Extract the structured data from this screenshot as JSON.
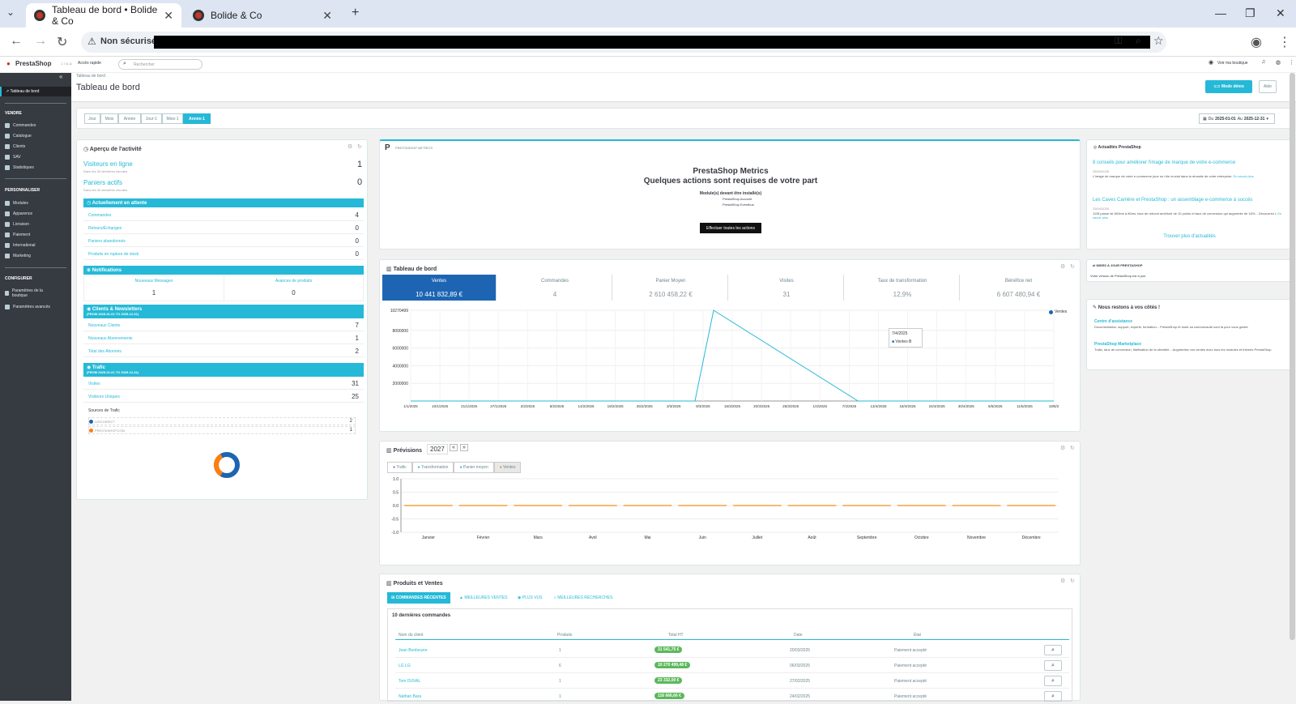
{
  "browser": {
    "tabs": [
      {
        "title": "Tableau de bord • Bolide & Co"
      },
      {
        "title": "Bolide & Co"
      }
    ],
    "security": "Non sécurisé"
  },
  "header": {
    "logo": "PrestaShop",
    "version": "1.7.8.11",
    "quick_access": "Accès rapide",
    "search_placeholder": "Rechercher",
    "view_shop": "Voir ma boutique"
  },
  "sidebar": {
    "dashboard": "Tableau de bord",
    "sections": [
      {
        "title": "VENDRE",
        "items": [
          "Commandes",
          "Catalogue",
          "Clients",
          "SAV",
          "Statistiques"
        ]
      },
      {
        "title": "PERSONNALISER",
        "items": [
          "Modules",
          "Apparence",
          "Livraison",
          "Paiement",
          "International",
          "Marketing"
        ]
      },
      {
        "title": "CONFIGURER",
        "items": [
          "Paramètres de la boutique",
          "Paramètres avancés"
        ]
      }
    ]
  },
  "page": {
    "breadcrumb": "Tableau de bord",
    "title": "Tableau de bord",
    "demo_button": "Mode démo",
    "help_button": "Aide"
  },
  "periods": [
    "Jour",
    "Mois",
    "Année",
    "Jour-1",
    "Mois-1",
    "Année-1"
  ],
  "active_period": "Année-1",
  "date_range": {
    "from_label": "Du",
    "from": "2025-01-01",
    "to_label": "Au",
    "to": "2025-12-31"
  },
  "activity": {
    "title": "Aperçu de l'activité",
    "online_visitors": {
      "label": "Visiteurs en ligne",
      "sub": "Dans les 30 dernières minutes",
      "value": "1"
    },
    "active_carts": {
      "label": "Paniers actifs",
      "sub": "Dans les 30 dernières minutes",
      "value": "0"
    },
    "pending": {
      "title": "Actuellement en attente",
      "rows": [
        {
          "label": "Commandes",
          "value": "4"
        },
        {
          "label": "Retours/Échanges",
          "value": "0"
        },
        {
          "label": "Paniers abandonnés",
          "value": "0"
        },
        {
          "label": "Produits en rupture de stock",
          "value": "0"
        }
      ]
    },
    "notifications": {
      "title": "Notifications",
      "cols": [
        {
          "label": "Nouveaux Messages",
          "value": "1"
        },
        {
          "label": "Avances de produits",
          "value": "0"
        }
      ]
    },
    "clients": {
      "title": "Clients & Newsletters",
      "sub": "(FROM 2025-01-01 TO 2025-12-31)",
      "rows": [
        {
          "label": "Nouveaux Clients",
          "value": "7"
        },
        {
          "label": "Nouveaux Abonnements",
          "value": "1"
        },
        {
          "label": "Total des Abonnés",
          "value": "2"
        }
      ]
    },
    "traffic": {
      "title": "Trafic",
      "sub": "(FROM 2025-01-01 TO 2025-12-31)",
      "rows": [
        {
          "label": "Visites",
          "value": "31"
        },
        {
          "label": "Visiteurs Uniques",
          "value": "25"
        }
      ],
      "sources_title": "Sources de Trafic",
      "sources": [
        {
          "label": "LIEN DIRECT",
          "value": "2",
          "color": "#1d65b3"
        },
        {
          "label": "PRESTASHOP.COM",
          "value": "1",
          "color": "#ff7f0e"
        }
      ]
    }
  },
  "metrics": {
    "title": "PRESTASHOP METRICS",
    "heading1": "PrestaShop Metrics",
    "heading2": "Quelques actions sont requises de votre part",
    "modules_title": "Module(s) devant être installé(s)",
    "modules": [
      "PrestaShop Account",
      "PrestaShop Eventbus"
    ],
    "action_button": "Effectuer toutes les actions"
  },
  "dashboard": {
    "title": "Tableau de bord",
    "kpis": [
      {
        "label": "Ventes",
        "value": "10 441 832,89 €"
      },
      {
        "label": "Commandes",
        "value": "4"
      },
      {
        "label": "Panier Moyen",
        "value": "2 610 458,22 €"
      },
      {
        "label": "Visites",
        "value": "31"
      },
      {
        "label": "Taux de transformation",
        "value": "12,9%"
      },
      {
        "label": "Bénéfice net",
        "value": "6 607 480,94 €"
      }
    ],
    "legend": "Ventes",
    "tooltip": {
      "date": "7/4/2025",
      "label": "Ventes",
      "value": "0"
    },
    "x_labels": [
      "1/1/2025",
      "10/1/2025",
      "21/1/2025",
      "27/1/2025",
      "2/2/2025",
      "8/2/2025",
      "14/2/2025",
      "19/2/2025",
      "25/2/2025",
      "3/3/2025",
      "9/3/2025",
      "15/3/2025",
      "20/3/2025",
      "26/3/2025",
      "1/4/2025",
      "7/4/2025",
      "13/4/2025",
      "18/4/2025",
      "24/4/2025",
      "30/4/2025",
      "6/5/2025",
      "11/5/2025",
      "19/5/2"
    ],
    "y_labels": [
      "10270499",
      "8000000",
      "6000000",
      "4000000",
      "2000000"
    ]
  },
  "chart_data": {
    "type": "line",
    "title": "Tableau de bord",
    "series": [
      {
        "name": "Ventes",
        "x": [
          "1/1/2025",
          "3/3/2025",
          "7/3/2025",
          "7/4/2025",
          "19/5/2025"
        ],
        "values": [
          0,
          0,
          10270499,
          0,
          0
        ]
      }
    ],
    "ylim": [
      0,
      10270499
    ]
  },
  "forecast": {
    "title": "Prévisions",
    "year": "2027",
    "tabs": [
      "Trafic",
      "Transformation",
      "Panier moyen",
      "Ventes"
    ],
    "months": [
      "Janvier",
      "Février",
      "Mars",
      "Avril",
      "Mai",
      "Juin",
      "Juillet",
      "Août",
      "Septembre",
      "Octobre",
      "Novembre",
      "Décembre"
    ],
    "y_labels": [
      "1.0",
      "0.5",
      "0.0",
      "-0.5",
      "-1.0"
    ]
  },
  "products": {
    "title": "Produits et Ventes",
    "tabs": [
      "COMMANDES RÉCENTES",
      "MEILLEURES VENTES",
      "PLUS VUS",
      "MEILLEURES RECHERCHES"
    ],
    "subtitle": "10 dernières commandes",
    "columns": [
      "Nom du client",
      "Produits",
      "Total HT",
      "Date",
      "État"
    ],
    "rows": [
      {
        "name": "Jean Bonbeurre",
        "products": "1",
        "total": "31 541,75 €",
        "date": "20/03/2025",
        "state": "Paiement accepté"
      },
      {
        "name": "LG LG",
        "products": "6",
        "total": "10 270 499,48 €",
        "date": "06/03/2025",
        "state": "Paiement accepté"
      },
      {
        "name": "Tom DUVAL",
        "products": "1",
        "total": "23 332,00 €",
        "date": "27/02/2025",
        "state": "Paiement accepté"
      },
      {
        "name": "Nathan Bara",
        "products": "1",
        "total": "116 666,66 €",
        "date": "24/02/2025",
        "state": "Paiement accepté"
      }
    ]
  },
  "news": {
    "title": "Actualités PrestaShop",
    "items": [
      {
        "title": "8 conseils pour améliorer l'image de marque de votre e-commerce",
        "date": "25/04/2025",
        "text": "L'image de marque de votre e-commerce joue un rôle crucial dans la réussite de votre entreprise.",
        "more": "En savoir plus"
      },
      {
        "title": "Les Caves Carrière et PrestaShop : un assemblage e-commerce à succès",
        "date": "23/04/2025",
        "text": "111€ passé de 800ms à 80ms, taux de rebond amélioré de 10 points et taux de conversion qui augmente de 16%... Découvrez L",
        "more": "En savoir plus"
      }
    ],
    "more": "Trouver plus d'actualités"
  },
  "updates": {
    "title": "MISES À JOUR PRESTASHOP",
    "text": "Votre version de PrestaShop est à jour"
  },
  "support": {
    "title": "Nous restons à vos côtés !",
    "items": [
      {
        "title": "Centre d'assistance",
        "text": "Documentation, support, experts, formation... PrestaShop et toute sa communauté sont là pour vous guider"
      },
      {
        "title": "PrestaShop Marketplace",
        "text": "Trafic, taux de conversion, fidélisation de la clientèle... Augmentez vos ventes avec tous les modules et thèmes PrestaShop"
      }
    ]
  }
}
